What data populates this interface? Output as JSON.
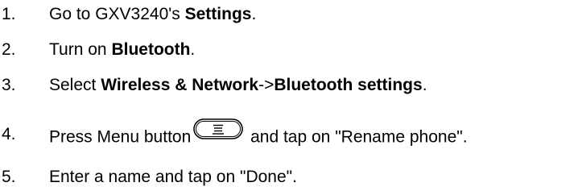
{
  "steps": [
    {
      "number": "1.",
      "parts": [
        "Go to GXV3240's ",
        "Settings",
        "."
      ]
    },
    {
      "number": "2.",
      "parts": [
        "Turn on ",
        "Bluetooth",
        "."
      ]
    },
    {
      "number": "3.",
      "parts": [
        "Select ",
        "Wireless & Network",
        "->",
        "Bluetooth settings",
        "."
      ]
    },
    {
      "number": "4.",
      "parts": [
        "Press Menu button",
        " and tap on \"Rename phone\"."
      ],
      "icon": "menu-button-icon"
    },
    {
      "number": "5.",
      "parts": [
        "Enter a name and tap on \"Done\"."
      ]
    }
  ]
}
